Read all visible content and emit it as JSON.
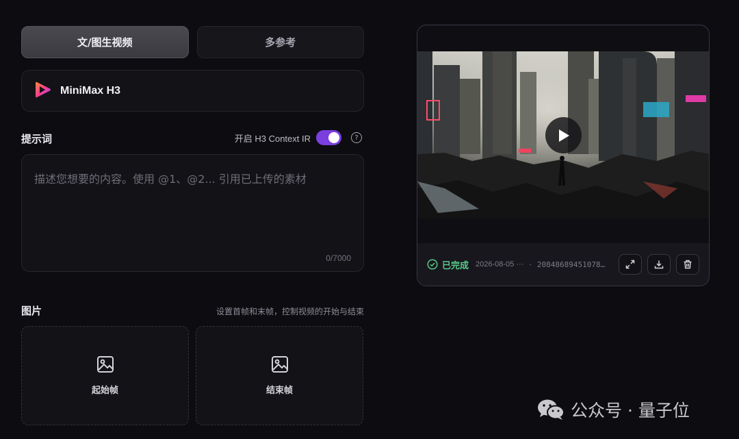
{
  "tabs": [
    {
      "label": "文/图生视频",
      "active": true
    },
    {
      "label": "多参考",
      "active": false
    }
  ],
  "model": {
    "name": "MiniMax H3",
    "icon": "minimax-play-logo"
  },
  "prompt": {
    "label": "提示词",
    "context_label": "开启 H3 Context IR",
    "context_enabled": true,
    "placeholder": "描述您想要的内容。使用 @1、@2... 引用已上传的素材",
    "value": "",
    "counter": "0/7000"
  },
  "images": {
    "label": "图片",
    "hint": "设置首帧和末帧，控制视频的开始与结束",
    "start_label": "起始帧",
    "end_label": "结束帧"
  },
  "video_card": {
    "status": "已完成",
    "date": "2026-08-05 ···",
    "separator": "·",
    "id": "20848689451078…",
    "actions": [
      "expand-icon",
      "download-icon",
      "trash-icon"
    ]
  },
  "watermark": {
    "text": "公众号 · 量子位"
  },
  "colors": {
    "accent": "#7b3fe0",
    "success": "#58c98a",
    "background": "#0d0c10"
  }
}
